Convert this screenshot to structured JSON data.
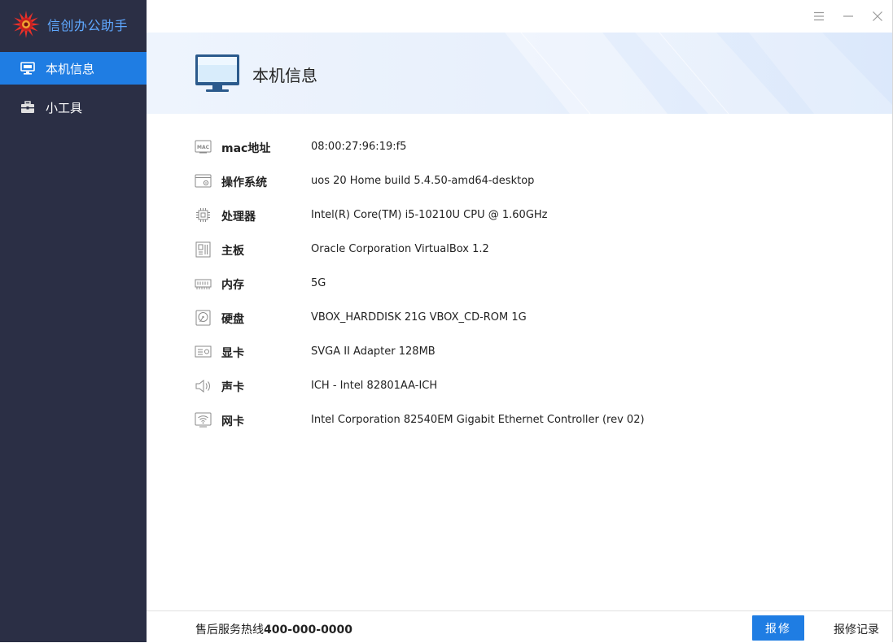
{
  "app": {
    "title": "信创办公助手"
  },
  "sidebar": {
    "items": [
      {
        "label": "本机信息",
        "icon": "monitor-icon",
        "active": true
      },
      {
        "label": "小工具",
        "icon": "toolbox-icon",
        "active": false
      }
    ]
  },
  "window_controls": [
    "menu-icon",
    "minimize-icon",
    "close-icon"
  ],
  "header": {
    "title": "本机信息"
  },
  "info": {
    "rows": [
      {
        "label": "mac地址",
        "value": "08:00:27:96:19:f5",
        "icon": "mac-icon"
      },
      {
        "label": "操作系统",
        "value": "uos 20 Home build 5.4.50-amd64-desktop",
        "icon": "os-window-icon"
      },
      {
        "label": "处理器",
        "value": "Intel(R) Core(TM) i5-10210U CPU @ 1.60GHz",
        "icon": "cpu-chip-icon"
      },
      {
        "label": "主板",
        "value": "Oracle Corporation VirtualBox 1.2",
        "icon": "motherboard-icon"
      },
      {
        "label": "内存",
        "value": "5G",
        "icon": "memory-icon"
      },
      {
        "label": "硬盘",
        "value": "VBOX_HARDDISK 21G VBOX_CD-ROM 1G",
        "icon": "hard-disk-icon"
      },
      {
        "label": "显卡",
        "value": "SVGA II Adapter 128MB",
        "icon": "graphics-card-icon"
      },
      {
        "label": "声卡",
        "value": "ICH - Intel 82801AA-ICH",
        "icon": "speaker-icon"
      },
      {
        "label": "网卡",
        "value": "Intel Corporation 82540EM Gigabit Ethernet Controller (rev 02)",
        "icon": "wifi-icon"
      }
    ]
  },
  "footer": {
    "hotline_label": "售后服务热线",
    "hotline_number": "400-000-0000",
    "repair_button": "报修",
    "repair_log": "报修记录"
  },
  "colors": {
    "sidebar_bg": "#2b2f45",
    "accent": "#1f7de3",
    "brand_text": "#5fa8ff"
  }
}
